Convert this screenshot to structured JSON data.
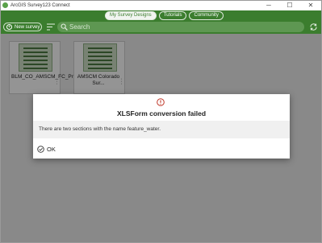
{
  "window": {
    "title": "ArcGIS Survey123 Connect",
    "minimize_glyph": "─",
    "maximize_glyph": "☐",
    "close_glyph": "✕"
  },
  "nav": {
    "tabs": [
      {
        "label": "My Survey Designs",
        "active": true
      },
      {
        "label": "Tutorials",
        "active": false
      },
      {
        "label": "Community",
        "active": false
      }
    ]
  },
  "toolbar": {
    "new_survey_label": "New survey",
    "new_survey_glyph": "+",
    "search_placeholder": "Search"
  },
  "surveys": [
    {
      "title": "BLM_CO_AMSCM_FC_Pro_Test"
    },
    {
      "title": "AMSCM Colorado Sur..."
    }
  ],
  "dialog": {
    "title": "XLSForm conversion failed",
    "message": "There are two sections with the name feature_water.",
    "ok_label": "OK"
  },
  "colors": {
    "brand_green": "#3b7d2e",
    "error_red": "#c0392b"
  },
  "icons": {
    "error": "error-icon",
    "ok": "check-circle-icon",
    "sync": "sync-icon",
    "search": "search-icon",
    "sort": "sort-icon"
  }
}
